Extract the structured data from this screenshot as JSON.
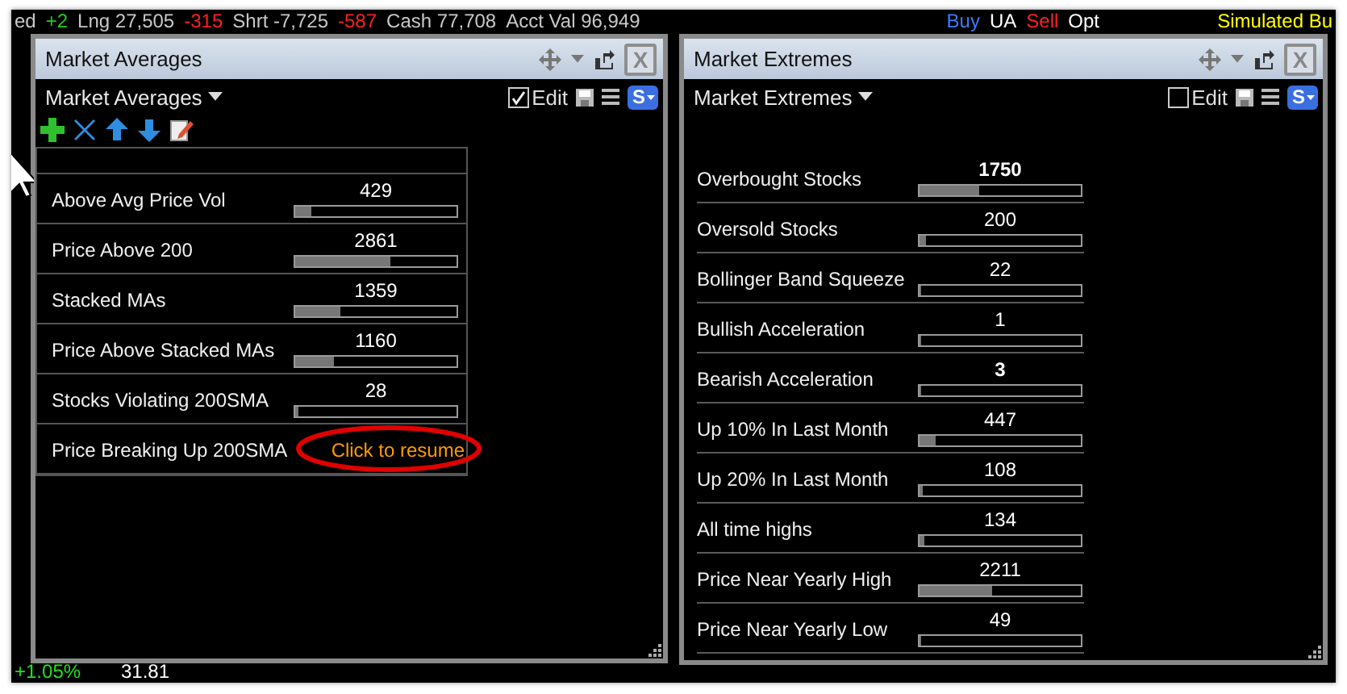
{
  "top_strip": {
    "left": [
      {
        "text": "ed",
        "color": "#c8c8c8"
      },
      {
        "text": "+2",
        "color": "#20d020"
      },
      {
        "text": "Lng 27,505",
        "color": "#c8c8c8"
      },
      {
        "text": "-315",
        "color": "#ff2020"
      },
      {
        "text": "Shrt -7,725",
        "color": "#c8c8c8"
      },
      {
        "text": "-587",
        "color": "#ff2020"
      },
      {
        "text": "Cash 77,708",
        "color": "#c8c8c8"
      },
      {
        "text": "Acct Val 96,949",
        "color": "#c8c8c8"
      }
    ],
    "right": [
      {
        "text": "Buy",
        "color": "#3a7bff"
      },
      {
        "text": "UA",
        "color": "#ffffff"
      },
      {
        "text": "Sell",
        "color": "#ff2020"
      },
      {
        "text": "Opt",
        "color": "#ffffff"
      }
    ],
    "mode": "Simulated Bu"
  },
  "windows": [
    {
      "title": "Market Averages",
      "close_label": "X",
      "list_name": "Market Averages",
      "edit": {
        "label": "Edit",
        "checked": true
      },
      "style_button": "S",
      "toolbar": true,
      "framed": true,
      "rows": [
        {
          "label": "Above Avg Price Vol",
          "value": "429",
          "level": 0.1,
          "highlighted": false
        },
        {
          "label": "Price Above 200",
          "value": "2861",
          "level": 0.59,
          "highlighted": false
        },
        {
          "label": "Stacked MAs",
          "value": "1359",
          "level": 0.28,
          "highlighted": false
        },
        {
          "label": "Price Above Stacked MAs",
          "value": "1160",
          "level": 0.24,
          "highlighted": false
        },
        {
          "label": "Stocks Violating 200SMA",
          "value": "28",
          "level": 0.02,
          "highlighted": false
        },
        {
          "label": "Price Breaking Up 200SMA",
          "resume": "Click to resume",
          "annotated": true
        }
      ]
    },
    {
      "title": "Market Extremes",
      "close_label": "X",
      "list_name": "Market Extremes",
      "edit": {
        "label": "Edit",
        "checked": false
      },
      "style_button": "S",
      "toolbar": false,
      "framed": false,
      "rows": [
        {
          "label": "Overbought Stocks",
          "value": "1750",
          "level": 0.37,
          "highlighted": true
        },
        {
          "label": "Oversold Stocks",
          "value": "200",
          "level": 0.04,
          "highlighted": false
        },
        {
          "label": "Bollinger Band Squeeze",
          "value": "22",
          "level": 0.01,
          "highlighted": false
        },
        {
          "label": "Bullish Acceleration",
          "value": "1",
          "level": 0,
          "highlighted": false
        },
        {
          "label": "Bearish Acceleration",
          "value": "3",
          "level": 0,
          "highlighted": true
        },
        {
          "label": "Up 10% In Last Month",
          "value": "447",
          "level": 0.1,
          "highlighted": false
        },
        {
          "label": "Up 20% In Last Month",
          "value": "108",
          "level": 0.02,
          "highlighted": false
        },
        {
          "label": "All time highs",
          "value": "134",
          "level": 0.03,
          "highlighted": false
        },
        {
          "label": "Price Near Yearly High",
          "value": "2211",
          "level": 0.45,
          "highlighted": false
        },
        {
          "label": "Price Near Yearly Low",
          "value": "49",
          "level": 0.01,
          "highlighted": false
        }
      ]
    }
  ],
  "bottom_strip": {
    "change": "+1.05%",
    "price": "31.81"
  }
}
